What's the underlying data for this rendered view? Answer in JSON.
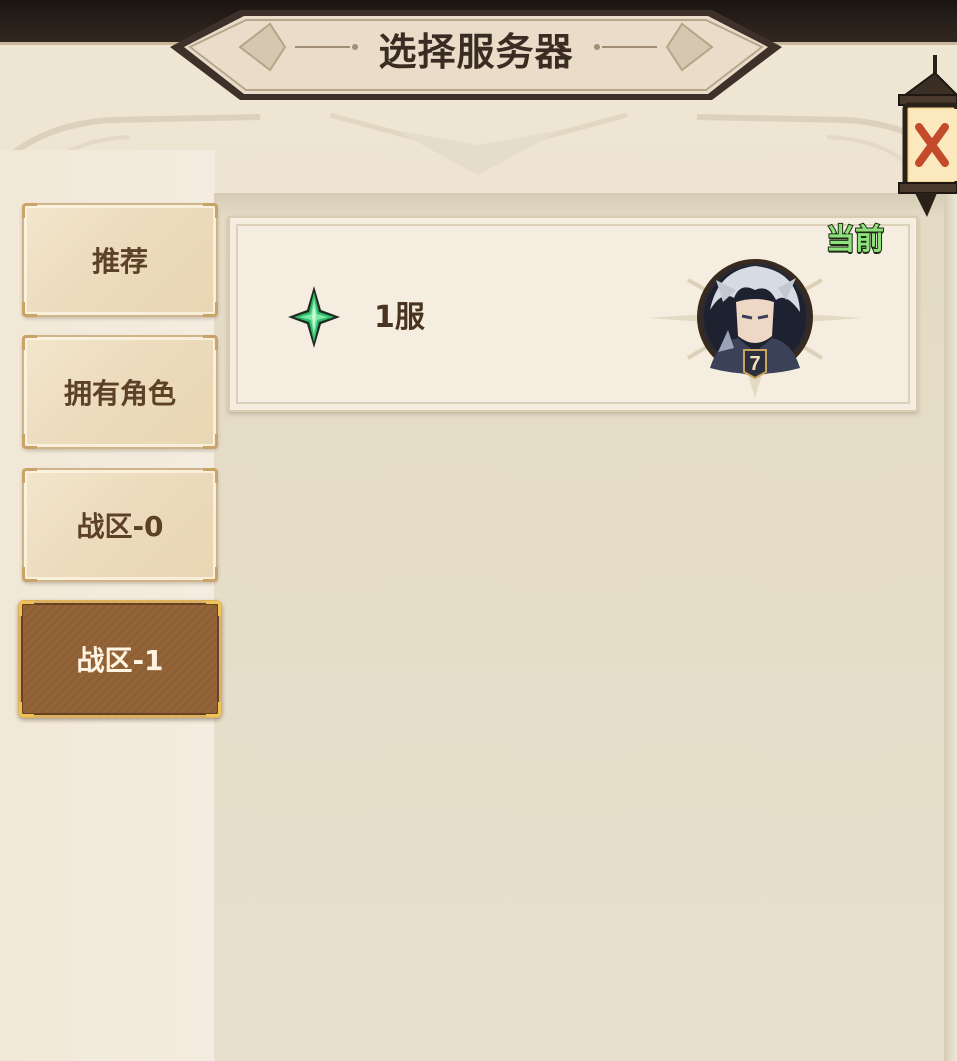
{
  "header": {
    "title": "选择服务器"
  },
  "close_button": {
    "icon": "lantern-close-icon"
  },
  "tabs": [
    {
      "label": "推荐",
      "active": false
    },
    {
      "label": "拥有角色",
      "active": false
    },
    {
      "label": "战区-0",
      "active": false
    },
    {
      "label": "战区-1",
      "active": true
    }
  ],
  "servers": [
    {
      "name": "1服",
      "status_icon": "green-star-gem-icon",
      "badge": "当前",
      "avatar": {
        "icon": "character-avatar-icon",
        "level": "7"
      }
    }
  ],
  "colors": {
    "panel_bg": "#ebe1cc",
    "tab_active": "#8e5f34",
    "badge_green": "#8ee07a",
    "title_text": "#3a2c22"
  }
}
